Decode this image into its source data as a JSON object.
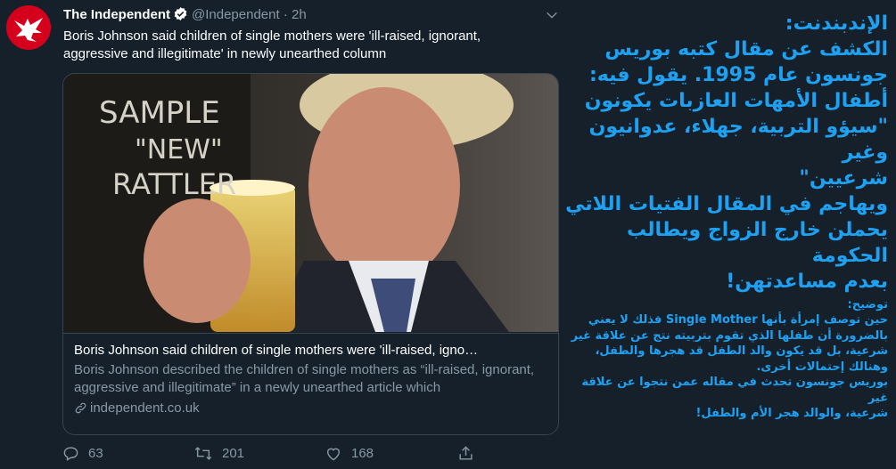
{
  "tweet": {
    "author_name": "The Independent",
    "handle": "@Independent",
    "separator": "·",
    "time": "2h",
    "text": "Boris Johnson said children of single mothers were 'ill-raised, ignorant, aggressive and illegitimate' in newly unearthed column"
  },
  "card": {
    "image_sign_text": "SAMPLE \"NEW\" RATTLER",
    "title": "Boris Johnson said children of single mothers were 'ill-raised, igno…",
    "description": "Boris Johnson described the children of single mothers as “ill-raised, ignorant, aggressive and illegitimate” in a newly unearthed article which",
    "domain": "independent.co.uk"
  },
  "actions": {
    "replies": "63",
    "retweets": "201",
    "likes": "168"
  },
  "overlay": {
    "title": "الإندبندنت:",
    "lines": [
      "الكشف عن مقال كتبه بوريس",
      "جونسون عام 1995. يقول فيه:",
      "أطفال الأمهات العازبات يكونون",
      "\"سيؤو التربية، جهلاء، عدوانيون وغير",
      "شرعيين\"",
      "ويهاجم في المقال الفتيات اللاتي",
      "يحملن خارج الزواج ويطالب الحكومة",
      "بعدم مساعدتهن!"
    ],
    "note_label": "توضيح:",
    "note_lines": [
      "حين توصف إمرأة بأنها Single Mother فذلك لا يعني",
      "بالضرورة أن طفلها الذي تقوم بتربيته نتج عن علاقة غير",
      "شرعية، بل قد يكون والد الطفل قد هجرها والطفل،",
      "وهنالك إحتمالات أخرى.",
      "بوريس جونسون تحدث في مقاله عمن نتجوا عن علاقة غير",
      "شرعية، والوالد هجر الأم والطفل!"
    ]
  },
  "colors": {
    "background": "#15202b",
    "muted_text": "#8899a6",
    "accent": "#1da1f2",
    "brand_red": "#d4001c",
    "border": "#38444d"
  },
  "icons": [
    "eagle-logo-icon",
    "verified-badge-icon",
    "chevron-down-icon",
    "link-icon",
    "reply-icon",
    "retweet-icon",
    "like-icon",
    "share-icon"
  ]
}
